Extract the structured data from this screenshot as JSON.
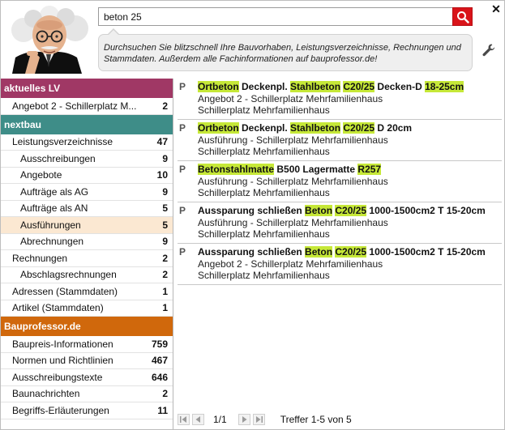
{
  "search": {
    "value": "beton 25"
  },
  "close_label": "✕",
  "tip": "Durchsuchen Sie blitzschnell Ihre Bauvorhaben, Leistungsverzeichnisse, Rechnungen und Stammdaten. Außerdem alle Fachinformationen auf bauprofessor.de!",
  "colors": {
    "accent_red": "#d9141a",
    "lv_head": "#a03865",
    "nextbau_head": "#3e8d88",
    "bauprofessor_head": "#d0680c",
    "highlight": "#c6e838"
  },
  "icons": {
    "search": "search-icon",
    "close": "close-icon",
    "settings": "wrench-icon",
    "avatar": "professor-avatar"
  },
  "sidebar": {
    "lv": {
      "title": "aktuelles LV",
      "items": [
        {
          "label": "Angebot 2 - Schillerplatz M...",
          "count": "2"
        }
      ]
    },
    "nextbau": {
      "title": "nextbau",
      "items": [
        {
          "label": "Leistungsverzeichnisse",
          "count": "47",
          "level": 1
        },
        {
          "label": "Ausschreibungen",
          "count": "9",
          "level": 2
        },
        {
          "label": "Angebote",
          "count": "10",
          "level": 2
        },
        {
          "label": "Aufträge als AG",
          "count": "9",
          "level": 2
        },
        {
          "label": "Aufträge als AN",
          "count": "5",
          "level": 2
        },
        {
          "label": "Ausführungen",
          "count": "5",
          "level": 2,
          "selected": true
        },
        {
          "label": "Abrechnungen",
          "count": "9",
          "level": 2
        },
        {
          "label": "Rechnungen",
          "count": "2",
          "level": 1
        },
        {
          "label": "Abschlagsrechnungen",
          "count": "2",
          "level": 2
        },
        {
          "label": "Adressen (Stammdaten)",
          "count": "1",
          "level": 1
        },
        {
          "label": "Artikel (Stammdaten)",
          "count": "1",
          "level": 1
        }
      ]
    },
    "bauprofessor": {
      "title": "Bauprofessor.de",
      "items": [
        {
          "label": "Baupreis-Informationen",
          "count": "759"
        },
        {
          "label": "Normen und Richtlinien",
          "count": "467"
        },
        {
          "label": "Ausschreibungstexte",
          "count": "646"
        },
        {
          "label": "Baunachrichten",
          "count": "2"
        },
        {
          "label": "Begriffs-Erläuterungen",
          "count": "11"
        }
      ]
    }
  },
  "results": [
    {
      "tag": "P",
      "title": [
        {
          "t": "Ortbeton",
          "hl": true
        },
        {
          "t": " Deckenpl. "
        },
        {
          "t": "Stahlbeton",
          "hl": true
        },
        {
          "t": " "
        },
        {
          "t": "C20/25",
          "hl": true
        },
        {
          "t": " Decken-D "
        },
        {
          "t": "18-25cm",
          "hl": true
        }
      ],
      "lines": [
        "Angebot 2 - Schillerplatz Mehrfamilienhaus",
        "Schillerplatz Mehrfamilienhaus"
      ]
    },
    {
      "tag": "P",
      "title": [
        {
          "t": "Ortbeton",
          "hl": true
        },
        {
          "t": " Deckenpl. "
        },
        {
          "t": "Stahlbeton",
          "hl": true
        },
        {
          "t": " "
        },
        {
          "t": "C20/25",
          "hl": true
        },
        {
          "t": " D 20cm"
        }
      ],
      "lines": [
        "Ausführung - Schillerplatz Mehrfamilienhaus",
        "Schillerplatz Mehrfamilienhaus"
      ]
    },
    {
      "tag": "P",
      "title": [
        {
          "t": "Betonstahlmatte",
          "hl": true
        },
        {
          "t": " B500 Lagermatte "
        },
        {
          "t": "R257",
          "hl": true
        }
      ],
      "lines": [
        "Ausführung - Schillerplatz Mehrfamilienhaus",
        "Schillerplatz Mehrfamilienhaus"
      ]
    },
    {
      "tag": "P",
      "title": [
        {
          "t": "Aussparung schließen "
        },
        {
          "t": "Beton",
          "hl": true
        },
        {
          "t": " "
        },
        {
          "t": "C20/25",
          "hl": true
        },
        {
          "t": " 1000-1500cm2 T 15-20cm"
        }
      ],
      "lines": [
        "Ausführung - Schillerplatz Mehrfamilienhaus",
        "Schillerplatz Mehrfamilienhaus"
      ]
    },
    {
      "tag": "P",
      "title": [
        {
          "t": "Aussparung schließen "
        },
        {
          "t": "Beton",
          "hl": true
        },
        {
          "t": " "
        },
        {
          "t": "C20/25",
          "hl": true
        },
        {
          "t": " 1000-1500cm2 T 15-20cm"
        }
      ],
      "lines": [
        "Angebot 2 - Schillerplatz Mehrfamilienhaus",
        "Schillerplatz Mehrfamilienhaus"
      ]
    }
  ],
  "pager": {
    "page_info": "1/1",
    "hits": "Treffer 1-5 von 5"
  }
}
